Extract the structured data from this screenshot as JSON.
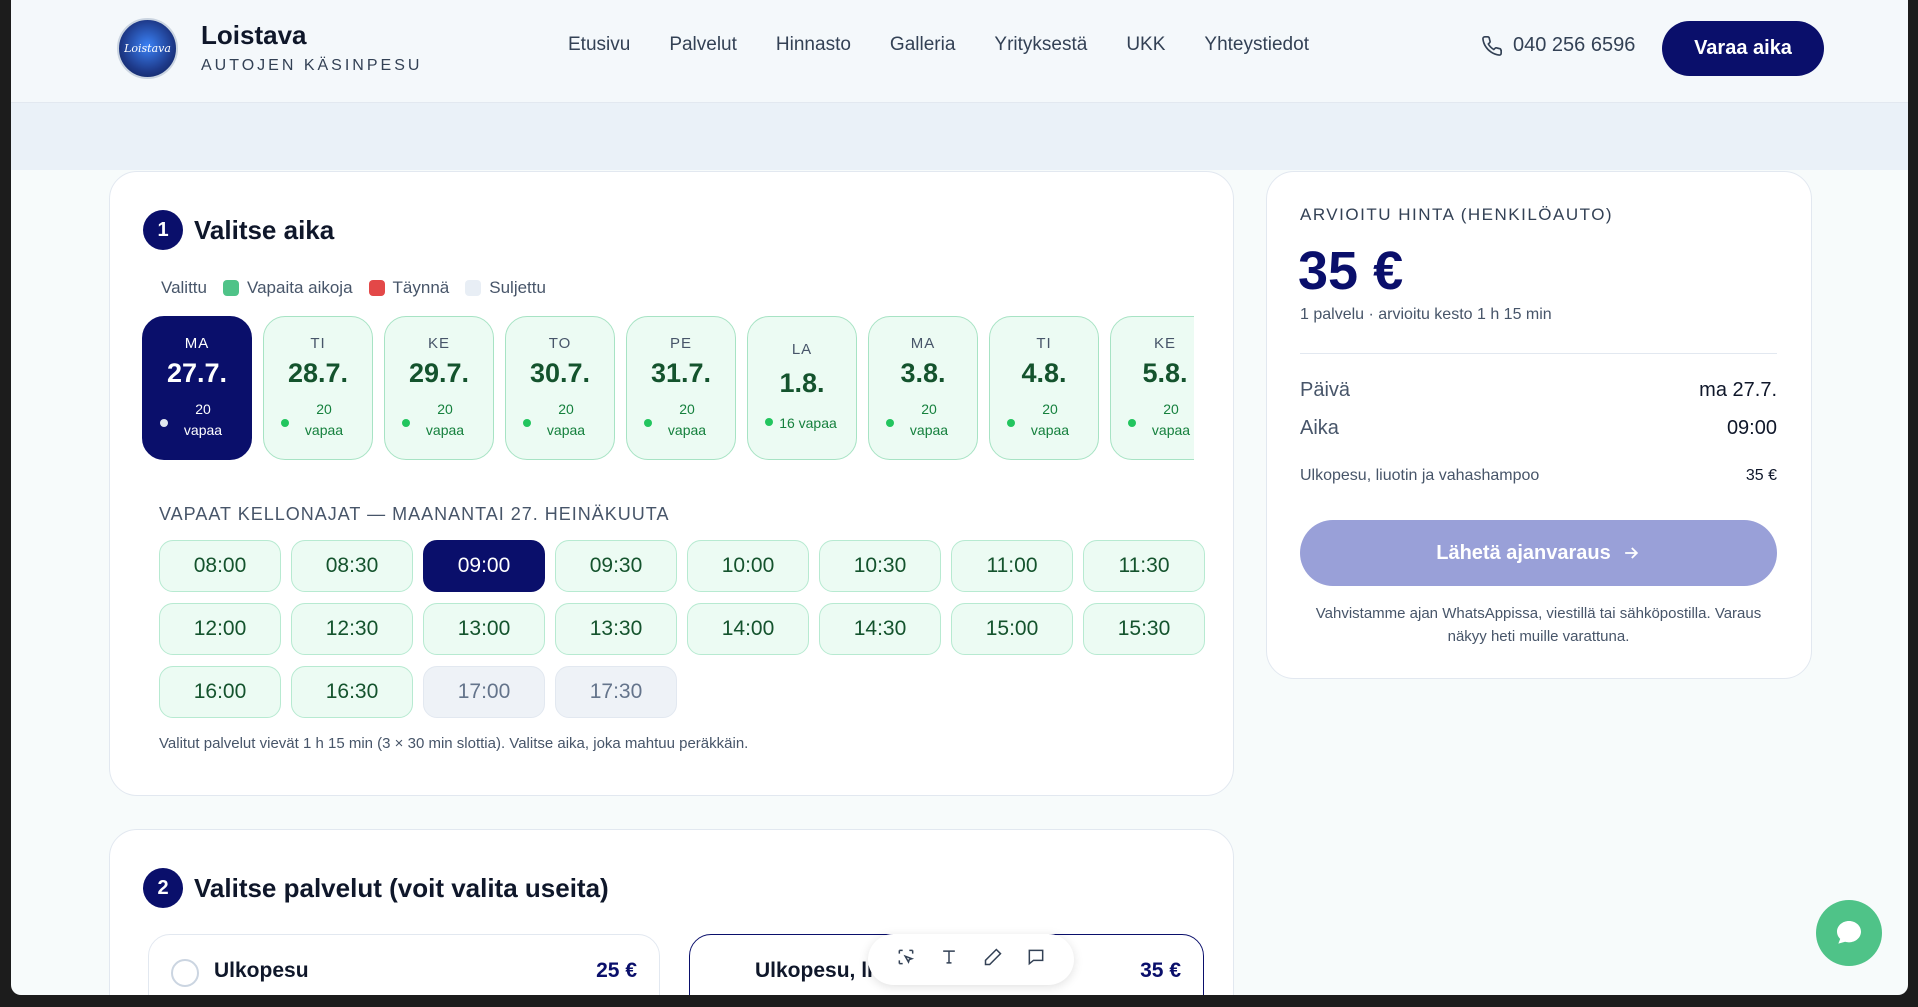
{
  "header": {
    "logo_text": "Loistava",
    "brand_name": "Loistava",
    "brand_sub": "AUTOJEN KÄSINPESU",
    "nav": [
      "Etusivu",
      "Palvelut",
      "Hinnasto",
      "Galleria",
      "Yrityksestä",
      "UKK",
      "Yhteystiedot"
    ],
    "phone": "040 256 6596",
    "cta": "Varaa aika"
  },
  "step1": {
    "number": "1",
    "title": "Valitse aika",
    "legend": [
      "Valittu",
      "Vapaita aikoja",
      "Täynnä",
      "Suljettu"
    ],
    "legend_colors": [
      "#ffffff",
      "#4fc388",
      "#e34848",
      "#e8eef5"
    ],
    "days": [
      {
        "name": "MA",
        "date": "27.7.",
        "free_count": "20",
        "free_unit": "vapaa",
        "selected": true
      },
      {
        "name": "TI",
        "date": "28.7.",
        "free_count": "20",
        "free_unit": "vapaa"
      },
      {
        "name": "KE",
        "date": "29.7.",
        "free_count": "20",
        "free_unit": "vapaa"
      },
      {
        "name": "TO",
        "date": "30.7.",
        "free_count": "20",
        "free_unit": "vapaa"
      },
      {
        "name": "PE",
        "date": "31.7.",
        "free_count": "20",
        "free_unit": "vapaa"
      },
      {
        "name": "LA",
        "date": "1.8.",
        "free_line": "16 vapaa"
      },
      {
        "name": "MA",
        "date": "3.8.",
        "free_count": "20",
        "free_unit": "vapaa"
      },
      {
        "name": "TI",
        "date": "4.8.",
        "free_count": "20",
        "free_unit": "vapaa"
      },
      {
        "name": "KE",
        "date": "5.8.",
        "free_count": "20",
        "free_unit": "vapaa"
      }
    ],
    "slots_title": "VAPAAT KELLONAJAT — MAANANTAI 27. HEINÄKUUTA",
    "slots": [
      {
        "time": "08:00",
        "state": "free"
      },
      {
        "time": "08:30",
        "state": "free"
      },
      {
        "time": "09:00",
        "state": "selected"
      },
      {
        "time": "09:30",
        "state": "free"
      },
      {
        "time": "10:00",
        "state": "free"
      },
      {
        "time": "10:30",
        "state": "free"
      },
      {
        "time": "11:00",
        "state": "free"
      },
      {
        "time": "11:30",
        "state": "free"
      },
      {
        "time": "12:00",
        "state": "free"
      },
      {
        "time": "12:30",
        "state": "free"
      },
      {
        "time": "13:00",
        "state": "free"
      },
      {
        "time": "13:30",
        "state": "free"
      },
      {
        "time": "14:00",
        "state": "free"
      },
      {
        "time": "14:30",
        "state": "free"
      },
      {
        "time": "15:00",
        "state": "free"
      },
      {
        "time": "15:30",
        "state": "free"
      },
      {
        "time": "16:00",
        "state": "free"
      },
      {
        "time": "16:30",
        "state": "free"
      },
      {
        "time": "17:00",
        "state": "closed"
      },
      {
        "time": "17:30",
        "state": "closed"
      }
    ],
    "note": "Valitut palvelut vievät 1 h 15 min (3 × 30 min slottia). Valitse aika, joka mahtuu peräkkäin."
  },
  "step2": {
    "number": "2",
    "title": "Valitse palvelut (voit valita useita)",
    "services": [
      {
        "name": "Ulkopesu",
        "price": "25 €"
      },
      {
        "name": "Ulkopesu, liu",
        "price": "35 €"
      }
    ]
  },
  "price": {
    "label": "ARVIOITU HINTA (HENKILÖAUTO)",
    "total": "35 €",
    "summary": "1 palvelu · arvioitu kesto 1 h 15 min",
    "day_label": "Päivä",
    "day_value": "ma 27.7.",
    "time_label": "Aika",
    "time_value": "09:00",
    "service_label": "Ulkopesu, liuotin ja vahashampoo",
    "service_price": "35 €",
    "submit": "Lähetä ajanvaraus",
    "info": "Vahvistamme ajan WhatsAppissa, viestillä tai sähköpostilla. Varaus näkyy heti muille varattuna."
  },
  "toolbar": {
    "icons": [
      "select-icon",
      "text-icon",
      "pen-icon",
      "comment-icon"
    ]
  },
  "chat": {
    "icon": "chat-bubble-icon",
    "color": "#4fc388"
  },
  "accent": "#0a0f6b"
}
